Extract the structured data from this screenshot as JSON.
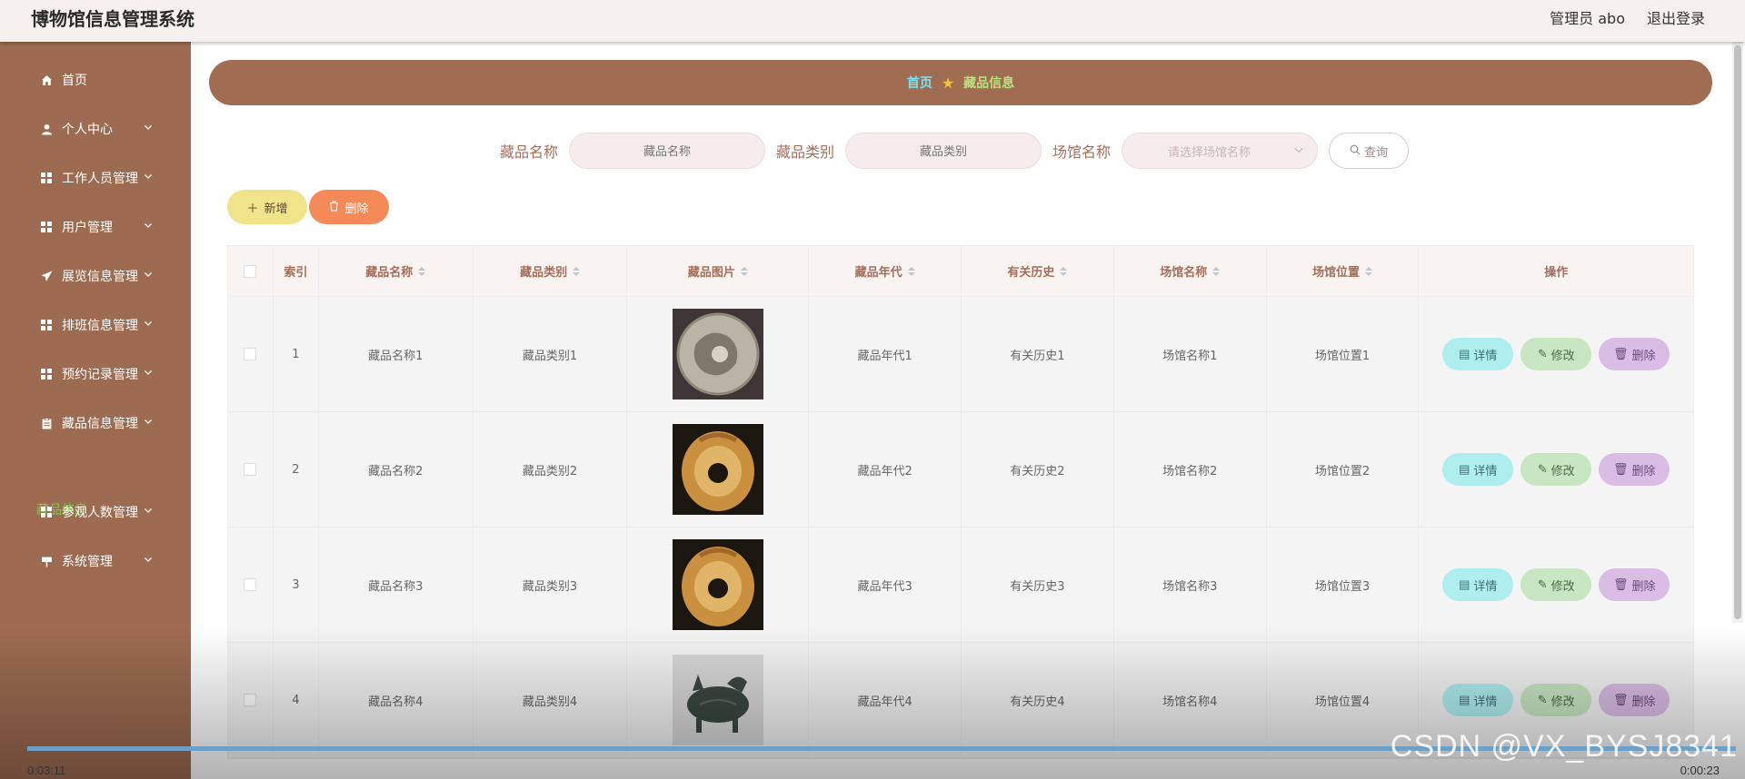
{
  "header": {
    "title": "博物馆信息管理系统",
    "admin_label": "管理员 abo",
    "logout_label": "退出登录"
  },
  "sidebar": {
    "items": [
      {
        "label": "首页",
        "icon": "home-icon"
      },
      {
        "label": "个人中心",
        "icon": "user-icon"
      },
      {
        "label": "工作人员管理",
        "icon": "grid-icon"
      },
      {
        "label": "用户管理",
        "icon": "grid-icon"
      },
      {
        "label": "展览信息管理",
        "icon": "send-icon"
      },
      {
        "label": "排班信息管理",
        "icon": "grid-icon"
      },
      {
        "label": "预约记录管理",
        "icon": "grid-icon"
      },
      {
        "label": "藏品信息管理",
        "icon": "clipboard-icon"
      },
      {
        "label": "参观人数管理",
        "icon": "grid-icon"
      },
      {
        "label": "系统管理",
        "icon": "sign-icon"
      }
    ],
    "active_submenu": "藏品信息"
  },
  "breadcrumb": {
    "home": "首页",
    "current": "藏品信息"
  },
  "search": {
    "name_label": "藏品名称",
    "name_placeholder": "藏品名称",
    "category_label": "藏品类别",
    "category_placeholder": "藏品类别",
    "venue_label": "场馆名称",
    "venue_placeholder": "请选择场馆名称",
    "query_label": "查询"
  },
  "actions": {
    "add_label": "新增",
    "delete_label": "删除"
  },
  "table": {
    "headers": [
      "索引",
      "藏品名称",
      "藏品类别",
      "藏品图片",
      "藏品年代",
      "有关历史",
      "场馆名称",
      "场馆位置",
      "操作"
    ],
    "rows": [
      {
        "index": "1",
        "name": "藏品名称1",
        "category": "藏品类别1",
        "era": "藏品年代1",
        "history": "有关历史1",
        "venue": "场馆名称1",
        "location": "场馆位置1",
        "image": "jade-disc-grey"
      },
      {
        "index": "2",
        "name": "藏品名称2",
        "category": "藏品类别2",
        "era": "藏品年代2",
        "history": "有关历史2",
        "venue": "场馆名称2",
        "location": "场馆位置2",
        "image": "jade-disc-amber"
      },
      {
        "index": "3",
        "name": "藏品名称3",
        "category": "藏品类别3",
        "era": "藏品年代3",
        "history": "有关历史3",
        "venue": "场馆名称3",
        "location": "场馆位置3",
        "image": "jade-disc-amber"
      },
      {
        "index": "4",
        "name": "藏品名称4",
        "category": "藏品类别4",
        "era": "藏品年代4",
        "history": "有关历史4",
        "venue": "场馆名称4",
        "location": "场馆位置4",
        "image": "bronze-vessel"
      }
    ],
    "op_detail": "详情",
    "op_edit": "修改",
    "op_delete": "删除"
  },
  "video": {
    "elapsed": "0:03:11",
    "remaining": "0:00:23",
    "watermark": "CSDN @VX_BYSJ8341"
  }
}
